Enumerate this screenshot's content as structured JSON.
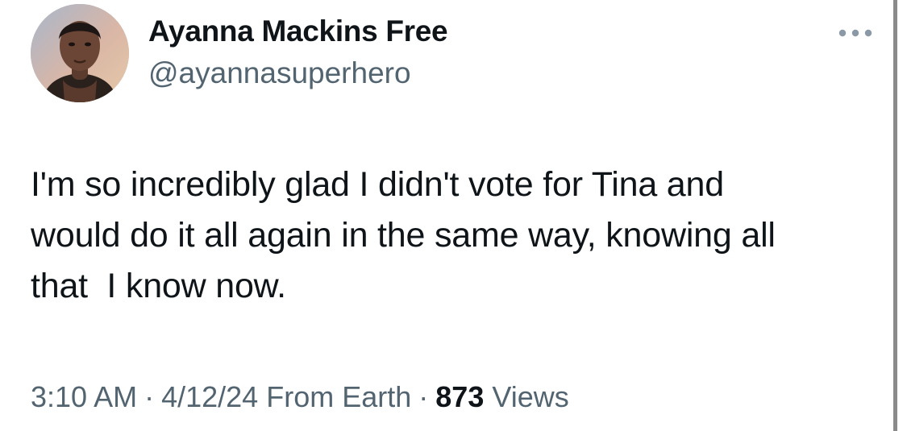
{
  "author": {
    "display_name": "Ayanna Mackins Free",
    "handle": "@ayannasuperhero"
  },
  "more_icon": "more-horizontal-icon",
  "tweet": {
    "text": "I'm so incredibly glad I didn't vote for Tina and\nwould do it all again in the same way, knowing all\nthat  I know now."
  },
  "meta": {
    "time": "3:10 AM",
    "date": "4/12/24",
    "source": "From Earth",
    "separator": "·",
    "views_count": "873",
    "views_label": "Views"
  },
  "colors": {
    "text": "#0f1419",
    "secondary": "#536471",
    "more_icon": "#8b98a5",
    "background": "#ffffff"
  }
}
